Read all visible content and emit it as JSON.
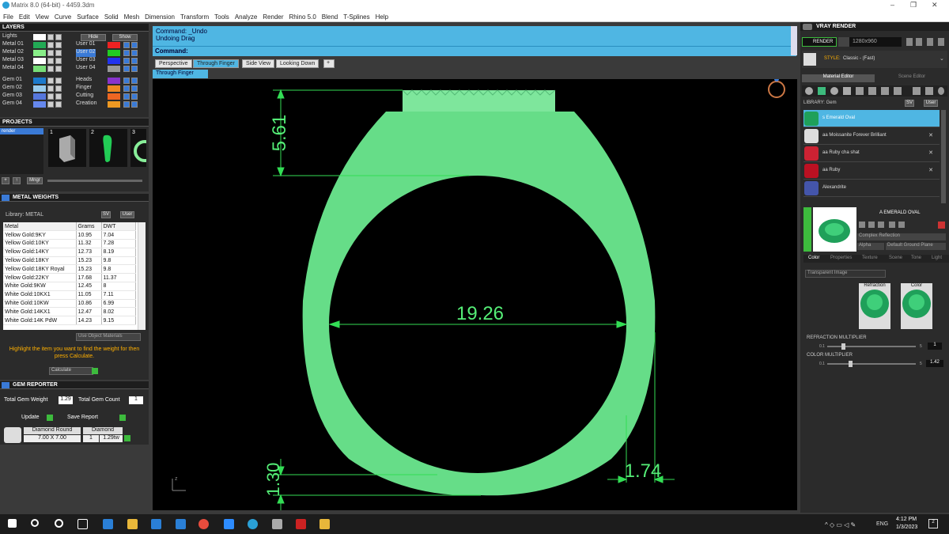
{
  "window": {
    "title": "Matrix 8.0 (64-bit) - 4459.3dm",
    "minimize": "–",
    "restore": "❐",
    "close": "✕"
  },
  "menu": [
    "File",
    "Edit",
    "View",
    "Curve",
    "Surface",
    "Solid",
    "Mesh",
    "Dimension",
    "Transform",
    "Tools",
    "Analyze",
    "Render",
    "Rhino 5.0",
    "Blend",
    "T-Splines",
    "Help"
  ],
  "layers": {
    "title": "LAYERS",
    "hide_label": "Hide",
    "show_label": "Show",
    "left": [
      {
        "name": "Lights",
        "color": "#ffffff"
      },
      {
        "name": "Metal 01",
        "color": "#22aa55"
      },
      {
        "name": "Metal 02",
        "color": "#88ee88"
      },
      {
        "name": "Metal 03",
        "color": "#ffffff"
      },
      {
        "name": "Metal 04",
        "color": "#77dd77"
      },
      {
        "name": "Gem 01",
        "color": "#1c7acc"
      },
      {
        "name": "Gem 02",
        "color": "#99ccee"
      },
      {
        "name": "Gem 03",
        "color": "#5577dd"
      },
      {
        "name": "Gem 04",
        "color": "#6688ee"
      }
    ],
    "right": [
      {
        "name": "User 01",
        "color": "#ee2222"
      },
      {
        "name": "User 02",
        "color": "#22cc22"
      },
      {
        "name": "User 03",
        "color": "#2233ee"
      },
      {
        "name": "User 04",
        "color": "#999999"
      },
      {
        "name": "Heads",
        "color": "#8833cc"
      },
      {
        "name": "Finger",
        "color": "#ee8822"
      },
      {
        "name": "Cutting",
        "color": "#ee6622"
      },
      {
        "name": "Creation",
        "color": "#ee9922"
      }
    ]
  },
  "projects": {
    "title": "PROJECTS",
    "item": "render",
    "thumbs": [
      "1",
      "2",
      "3"
    ],
    "manager_label": "Mngr"
  },
  "metal_weights": {
    "title": "METAL WEIGHTS",
    "library_label": "Library: METAL",
    "sv_label": "SV",
    "user_label": "User",
    "columns": [
      "Metal",
      "Grams",
      "DWT"
    ],
    "rows": [
      [
        "Yellow Gold:9KY",
        "10.95",
        "7.04"
      ],
      [
        "Yellow Gold:10KY",
        "11.32",
        "7.28"
      ],
      [
        "Yellow Gold:14KY",
        "12.73",
        "8.19"
      ],
      [
        "Yellow Gold:18KY",
        "15.23",
        "9.8"
      ],
      [
        "Yellow Gold:18KY Royal",
        "15.23",
        "9.8"
      ],
      [
        "Yellow Gold:22KY",
        "17.68",
        "11.37"
      ],
      [
        "White Gold:9KW",
        "12.45",
        "8"
      ],
      [
        "White Gold:10KX1",
        "11.05",
        "7.11"
      ],
      [
        "White Gold:10KW",
        "10.86",
        "6.99"
      ],
      [
        "White Gold:14KX1",
        "12.47",
        "8.02"
      ],
      [
        "White Gold:14K PdW",
        "14.23",
        "9.15"
      ]
    ],
    "use_object_materials": "Use Object Materials",
    "hint": "Highlight the item you want to find the weight for then press Calculate.",
    "calculate_label": "Calculate"
  },
  "gem_reporter": {
    "title": "GEM REPORTER",
    "total_weight_label": "Total Gem Weight",
    "total_weight": "1.29",
    "total_count_label": "Total Gem Count",
    "total_count": "1",
    "update_label": "Update",
    "save_report_label": "Save Report",
    "gem_name": "Diamond Round",
    "gem_size": "7.00 X 7.00",
    "gem_type": "Diamond",
    "gem_qty": "1",
    "gem_weight": "1.29tw"
  },
  "command": {
    "line1": "Command: _Undo",
    "line2": "Undoing Drag",
    "prompt": "Command:",
    "value": ""
  },
  "viewport_tabs": [
    "Perspective",
    "Through Finger",
    "Side View",
    "Looking Down"
  ],
  "viewport_add": "+",
  "active_viewport": "Through Finger",
  "dimensions": {
    "top_height": "5.61",
    "inner_diameter": "19.26",
    "bottom_thickness": "1.30",
    "side_thickness": "1.74"
  },
  "axis_label": "z",
  "vray": {
    "title": "VRAY RENDER",
    "render_label": "RENDER",
    "resolution": "1280x960",
    "style_label": "STYLE:",
    "style_value": "Classic - (Fast)",
    "tabs": [
      "Material Editor",
      "Scene Editor"
    ],
    "library_label": "LIBRARY: Gem",
    "sv_label": "SV",
    "user_label": "User",
    "materials": [
      {
        "name": "s Emerald Oval",
        "color": "#1fa05a"
      },
      {
        "name": "aa Moissanite Forever Brilliant",
        "color": "#dddddd"
      },
      {
        "name": "aa Ruby cha shat",
        "color": "#cc2233"
      },
      {
        "name": "aa Ruby",
        "color": "#bb1122"
      },
      {
        "name": "Alexandrite",
        "color": "#4455aa"
      }
    ],
    "selected_material": "A EMERALD OVAL",
    "complex_reflection": "Complex Reflection",
    "alpha_label": "Alpha",
    "ground_plane": "Default Ground Plane",
    "sub_tabs": [
      "Color",
      "Properties",
      "Texture",
      "Scene",
      "Tone",
      "Light"
    ],
    "transparent_image": "Transparent Image",
    "refraction_label": "Refraction",
    "color_label": "Color",
    "refraction_multiplier_label": "REFRACTION MULTIPLIER",
    "refraction_min": "0.1",
    "refraction_max": "5",
    "refraction_value": "1",
    "color_multiplier_label": "COLOR MULTIPLIER",
    "color_min": "0.1",
    "color_max": "5",
    "color_value": "1.42"
  },
  "taskbar": {
    "time": "4:12 PM",
    "date": "1/3/2023",
    "lang": "ENG",
    "notif_count": "2"
  }
}
